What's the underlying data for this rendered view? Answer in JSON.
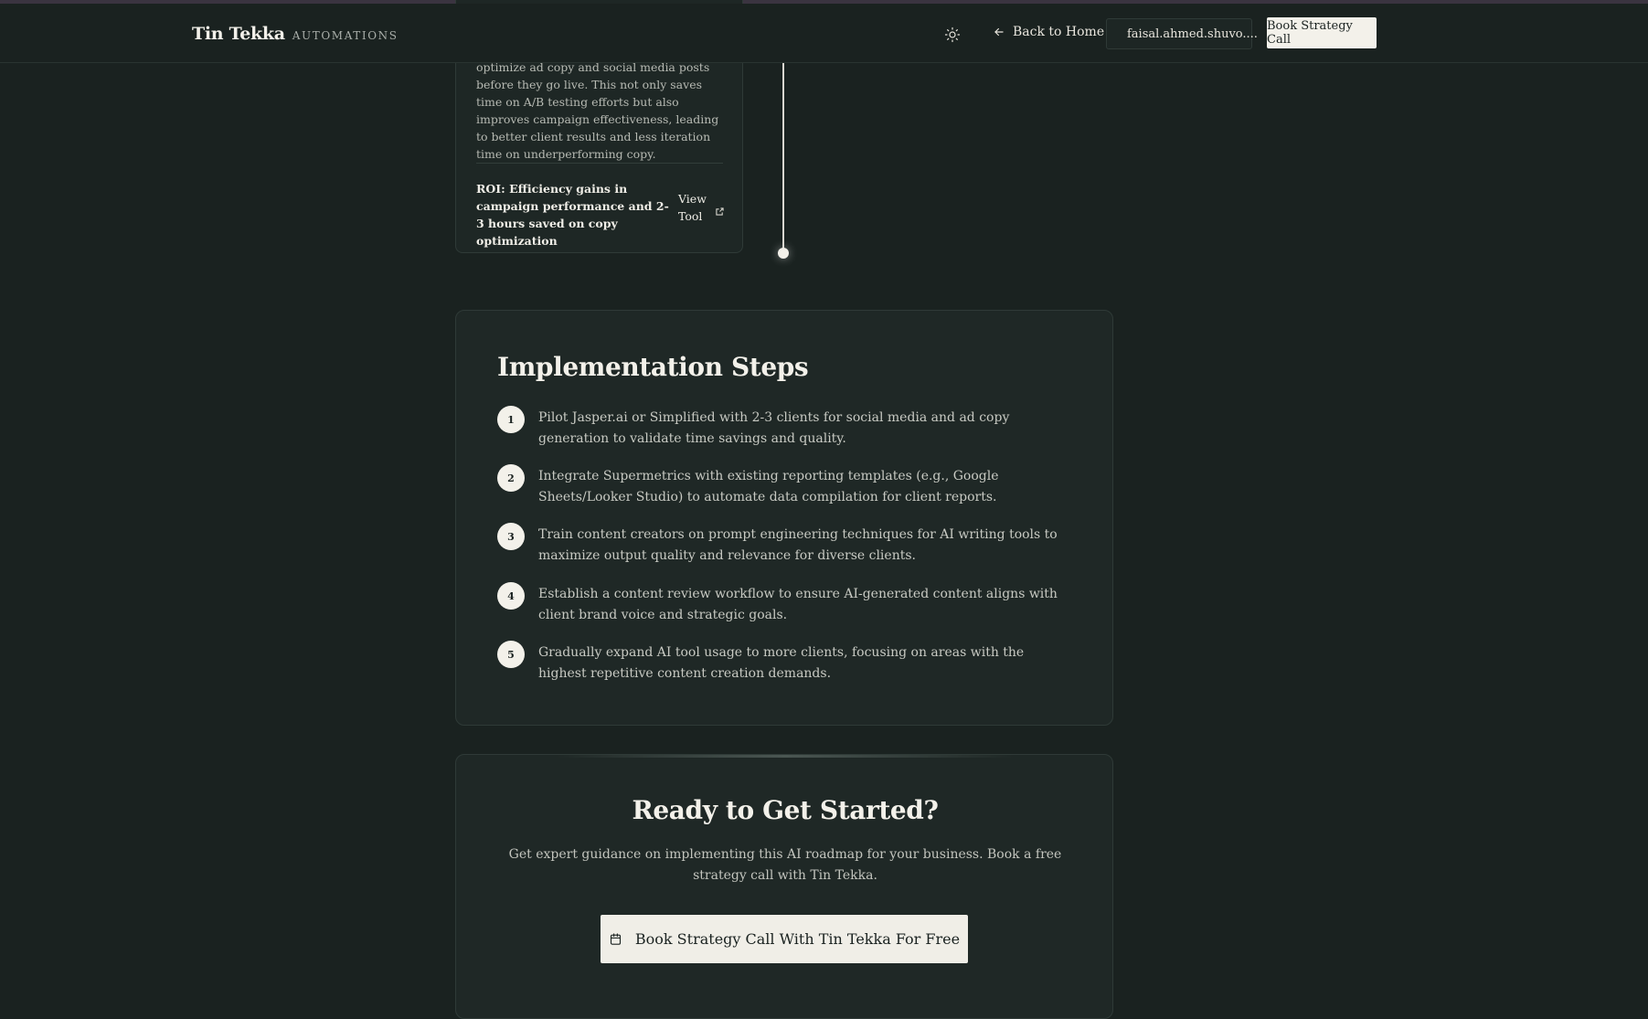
{
  "header": {
    "brand_name": "Tin Tekka",
    "brand_sub": "AUTOMATIONS",
    "back_label": "Back to Home",
    "user_label": "faisal.ahmed.shuvo....",
    "cta_label": "Book Strategy Call"
  },
  "timeline_card": {
    "description": "optimize ad copy and social media posts before they go live. This not only saves time on A/B testing efforts but also improves campaign effectiveness, leading to better client results and less iteration time on underperforming copy.",
    "roi": "ROI: Efficiency gains in campaign performance and 2-3 hours saved on copy optimization",
    "view_label": "View Tool"
  },
  "steps": {
    "title": "Implementation Steps",
    "items": [
      {
        "num": "1",
        "text": "Pilot Jasper.ai or Simplified with 2-3 clients for social media and ad copy generation to validate time savings and quality."
      },
      {
        "num": "2",
        "text": "Integrate Supermetrics with existing reporting templates (e.g., Google Sheets/Looker Studio) to automate data compilation for client reports."
      },
      {
        "num": "3",
        "text": "Train content creators on prompt engineering techniques for AI writing tools to maximize output quality and relevance for diverse clients."
      },
      {
        "num": "4",
        "text": "Establish a content review workflow to ensure AI-generated content aligns with client brand voice and strategic goals."
      },
      {
        "num": "5",
        "text": "Gradually expand AI tool usage to more clients, focusing on areas with the highest repetitive content creation demands."
      }
    ]
  },
  "cta": {
    "title": "Ready to Get Started?",
    "text": "Get expert guidance on implementing this AI roadmap for your business. Book a free strategy call with Tin Tekka.",
    "button_label": "Book Strategy Call With Tin Tekka For Free"
  },
  "icons": {
    "theme": "sun-icon",
    "back": "arrow-left-icon",
    "user": "user-icon",
    "external": "external-link-icon",
    "calendar": "calendar-icon"
  },
  "colors": {
    "background": "#1a2220",
    "card": "#1f2826",
    "accent": "#f3f1ea"
  }
}
